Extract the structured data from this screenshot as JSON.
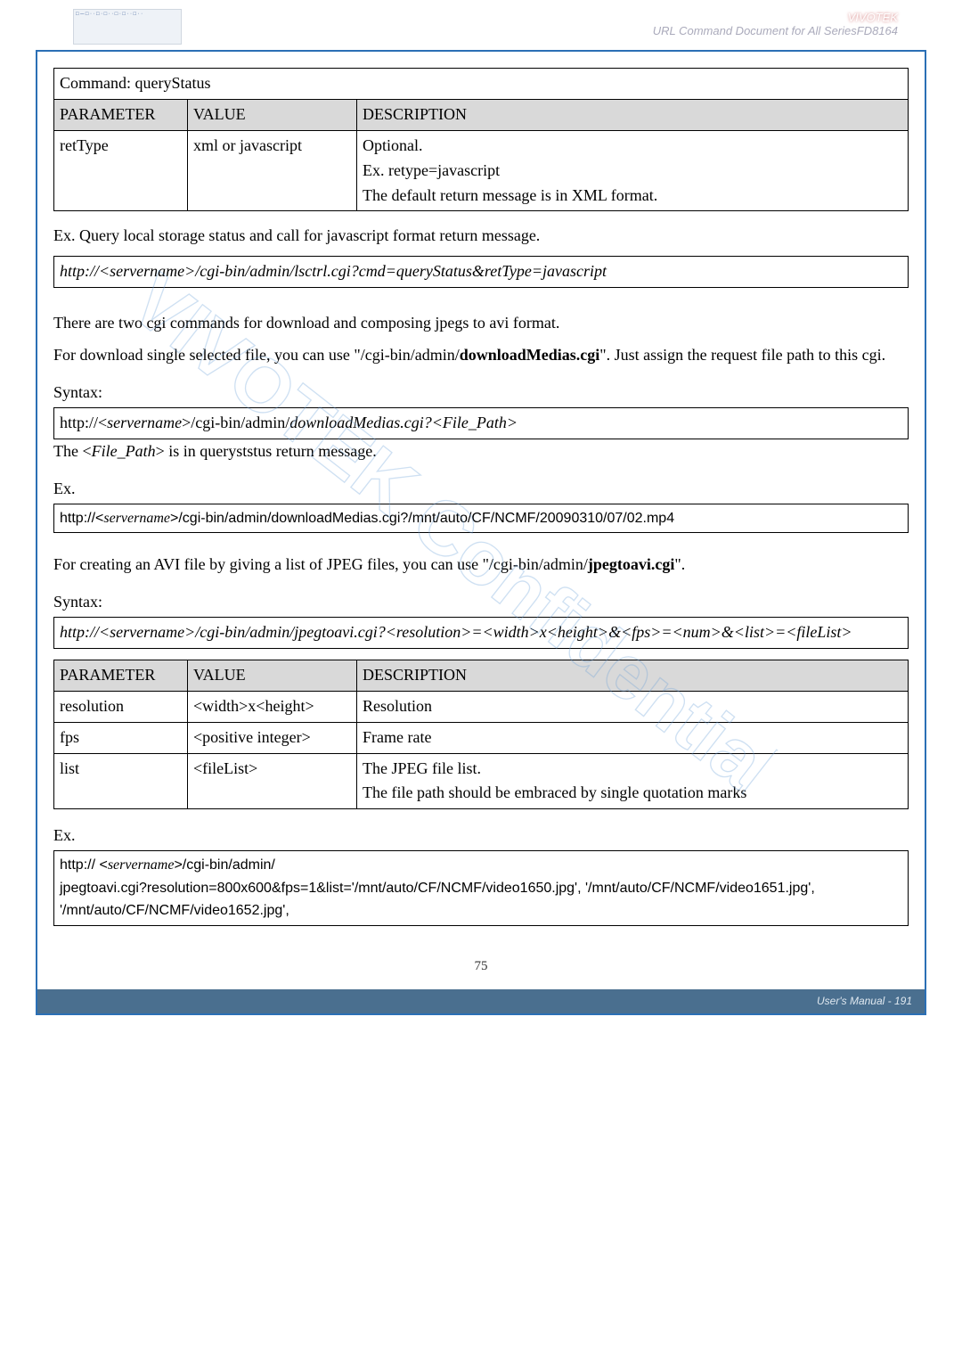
{
  "header": {
    "brand": "VIVOTEK",
    "subtitle": "URL Command Document for All SeriesFD8164"
  },
  "section1": {
    "command_label": "Command: queryStatus",
    "table": {
      "h1": "PARAMETER",
      "h2": "VALUE",
      "h3": "DESCRIPTION",
      "r1c1": "retType",
      "r1c2": "xml or javascript",
      "r1c3a": "Optional.",
      "r1c3b": "Ex. retype=javascript",
      "r1c3c": "The default return message is in XML format."
    },
    "ex_label": "Ex. Query local storage status and call for javascript format return message.",
    "ex_code": "http://<servername>/cgi-bin/admin/lsctrl.cgi?cmd=queryStatus&retType=javascript"
  },
  "section2": {
    "p1": "There are two cgi commands for download and composing jpegs to avi format.",
    "p2a": "For download single selected file, you can use \"/cgi-bin/admin/",
    "p2b": "downloadMedias.cgi",
    "p2c": "\". Just assign the request file path to this cgi.",
    "syntax_label": "Syntax:",
    "syntax_code_a": "http://<",
    "syntax_code_b": "servername",
    "syntax_code_c": ">/cgi-bin/admin/",
    "syntax_code_d": "downloadMedias.cgi?<File_Path>",
    "note_a": "The <",
    "note_b": "File_Path",
    "note_c": "> is in queryststus return message.",
    "ex_label": "Ex.",
    "ex_code_a": "http://<",
    "ex_code_b": "servername",
    "ex_code_c": ">/cgi-bin/admin/downloadMedias.cgi?/mnt/auto/CF/NCMF/20090310/07/02.mp4"
  },
  "section3": {
    "p_a": "For creating an AVI file by giving a list of JPEG files, you can use \"/cgi-bin/admin/",
    "p_b": "jpegtoavi.cgi",
    "p_c": "\".",
    "syntax_label": "Syntax:",
    "syntax_code": "http://<servername>/cgi-bin/admin/jpegtoavi.cgi?<resolution>=<width>x<height>&<fps>=<num>&<list>=<fileList>",
    "table": {
      "h1": "PARAMETER",
      "h2": "VALUE",
      "h3": "DESCRIPTION",
      "r1c1": "resolution",
      "r1c2": "<width>x<height>",
      "r1c3": "Resolution",
      "r2c1": "fps",
      "r2c2": "<positive integer>",
      "r2c3": "Frame rate",
      "r3c1": "list",
      "r3c2": "<fileList>",
      "r3c3a": "The JPEG file list.",
      "r3c3b": "The file path should be embraced by single quotation marks"
    },
    "ex_label": "Ex.",
    "ex_code_a": "http:// <",
    "ex_code_b": "servername",
    "ex_code_c": ">/cgi-bin/admin/",
    "ex_code_d": "jpegtoavi.cgi?resolution=800x600&fps=1&list='/mnt/auto/CF/NCMF/video1650.jpg', '/mnt/auto/CF/NCMF/video1651.jpg', '/mnt/auto/CF/NCMF/video1652.jpg',"
  },
  "footer": {
    "page_inner": "75",
    "manual_label": "User's Manual - 191"
  },
  "watermark": "VIVOTEK Confidential"
}
